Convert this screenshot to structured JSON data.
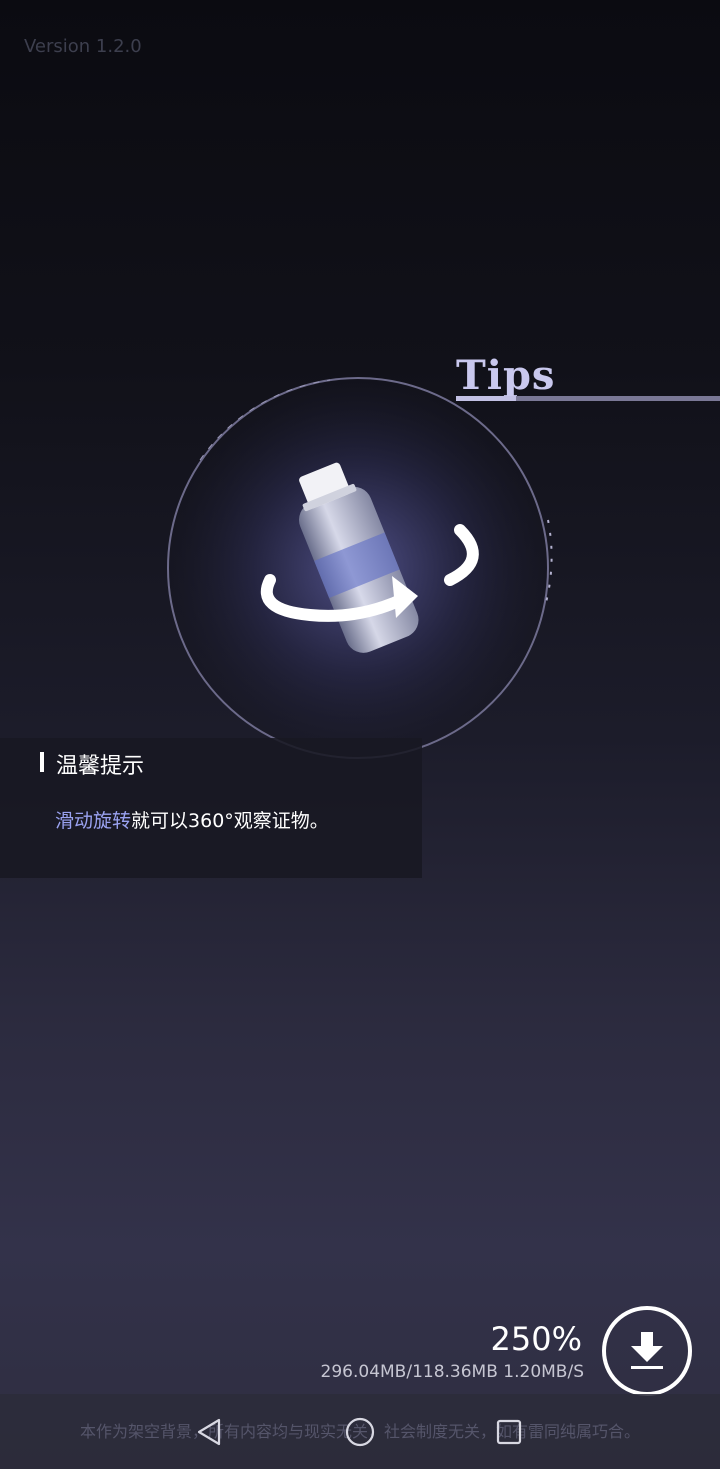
{
  "header": {
    "version": "Version 1.2.0"
  },
  "tips": {
    "title": "Tips",
    "heading": "温馨提示",
    "body_highlight": "滑动旋转",
    "body_rest": "就可以360°观察证物。"
  },
  "download": {
    "percent": "250%",
    "stats": "296.04MB/118.36MB 1.20MB/S",
    "icon": "download-icon"
  },
  "footer": {
    "disclaimer": "本作为架空背景，所有内容均与现实无关，社会制度无关，如有雷同纯属巧合。"
  },
  "nav": {
    "back_icon": "back-triangle-icon",
    "home_icon": "home-circle-icon",
    "recent_icon": "recent-square-icon"
  },
  "colors": {
    "accent": "#9aa2f0",
    "tips_title": "#c9c8ee"
  }
}
